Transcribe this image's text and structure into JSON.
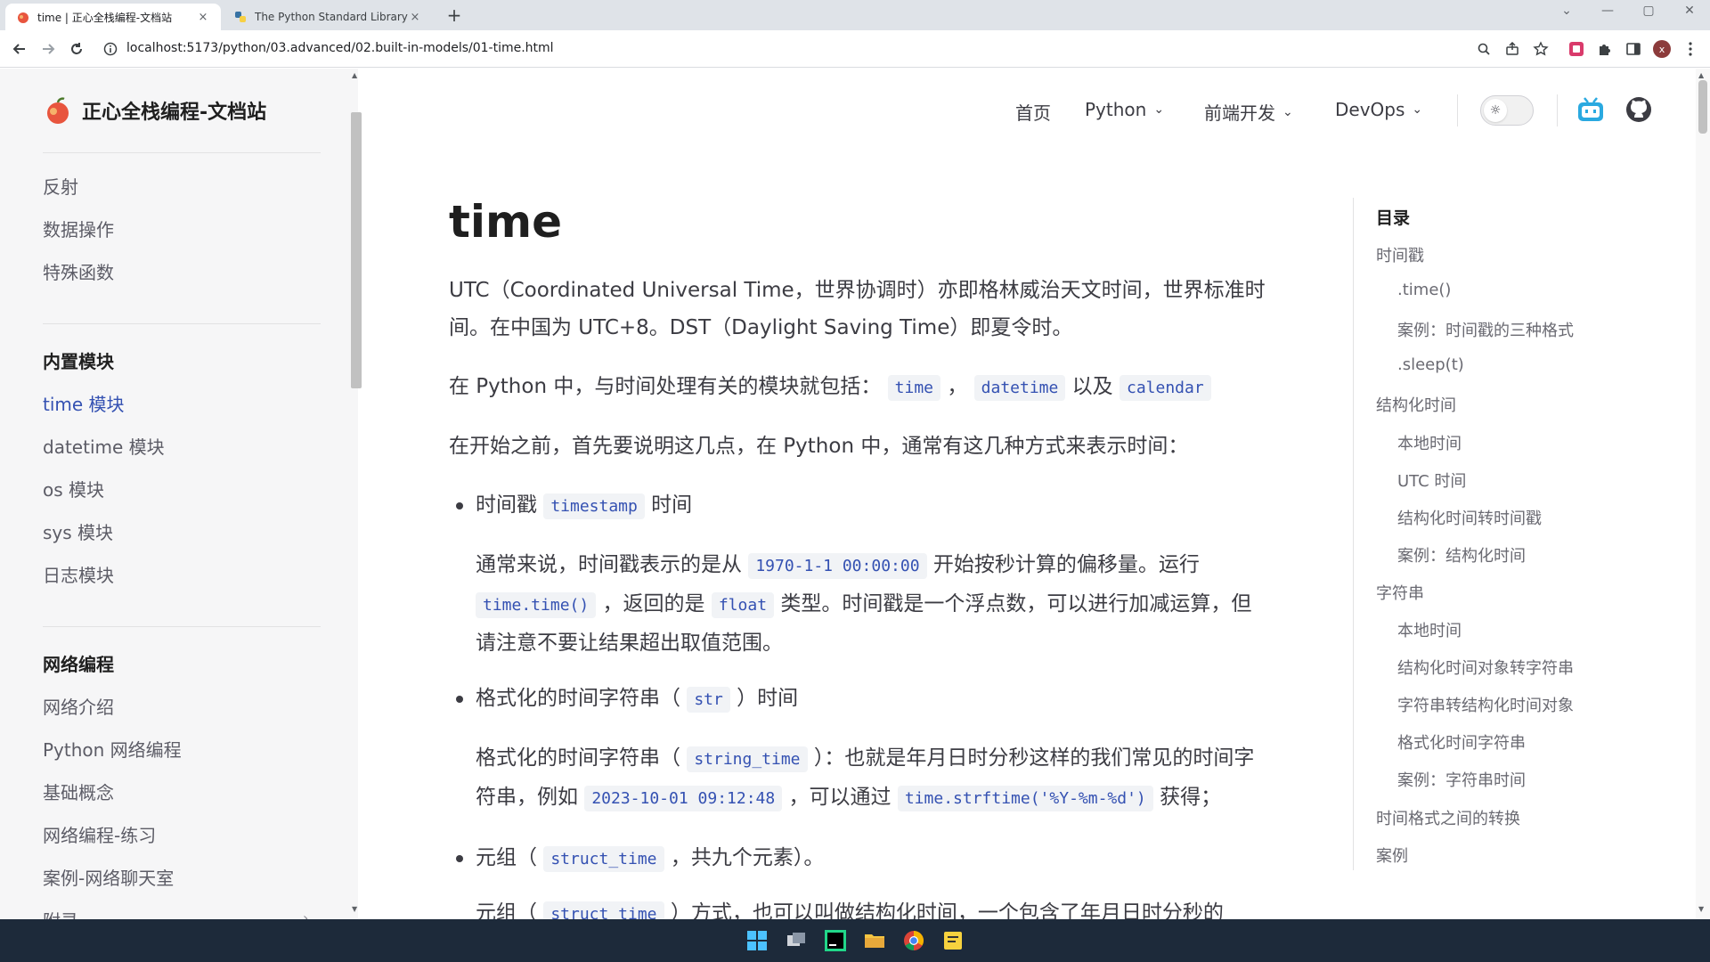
{
  "browser": {
    "tabs": [
      {
        "label": "time | 正心全栈编程-文档站",
        "close": "×",
        "active": true
      },
      {
        "label": "The Python Standard Library ·",
        "close": "×",
        "active": false
      }
    ],
    "new_tab": "+",
    "address": "localhost:5173/python/03.advanced/02.built-in-models/01-time.html",
    "window_controls": {
      "collapse": "⌄",
      "minimize": "—",
      "maximize": "▢",
      "close": "✕"
    },
    "profile_initial": "x"
  },
  "site": {
    "name": "正心全栈编程-文档站"
  },
  "nav": {
    "home": "首页",
    "python": "Python",
    "frontend": "前端开发",
    "devops": "DevOps"
  },
  "sidebar": {
    "top_items": [
      "反射",
      "数据操作",
      "特殊函数"
    ],
    "group1_title": "内置模块",
    "group1_items": [
      "time 模块",
      "datetime 模块",
      "os 模块",
      "sys 模块",
      "日志模块"
    ],
    "group2_title": "网络编程",
    "group2_items": [
      "网络介绍",
      "Python 网络编程",
      "基础概念",
      "网络编程-练习",
      "案例-网络聊天室"
    ],
    "cut_item": "附录"
  },
  "content": {
    "title": "time",
    "p1": "UTC（Coordinated Universal Time，世界协调时）亦即格林威治天文时间，世界标准时间。在中国为 UTC+8。DST（Daylight Saving Time）即夏令时。",
    "p2_a": "在 Python 中，与时间处理有关的模块就包括：",
    "p2_code1": "time",
    "p2_b": "，",
    "p2_code2": "datetime",
    "p2_c": "以及",
    "p2_code3": "calendar",
    "p3": "在开始之前，首先要说明这几点，在 Python 中，通常有这几种方式来表示时间：",
    "b1_a": "时间戳",
    "b1_code": "timestamp",
    "b1_b": "时间",
    "b1p_a": "通常来说，时间戳表示的是从",
    "b1p_code1": "1970-1-1 00:00:00",
    "b1p_b": "开始按秒计算的偏移量。运行",
    "b1p_code2": "time.time()",
    "b1p_c": "，返回的是",
    "b1p_code3": "float",
    "b1p_d": "类型。时间戳是一个浮点数，可以进行加减运算，但请注意不要让结果超出取值范围。",
    "b2_a": "格式化的时间字符串（",
    "b2_code": "str",
    "b2_b": "）时间",
    "b2p_a": "格式化的时间字符串（",
    "b2p_code1": "string_time",
    "b2p_b": "）：也就是年月日时分秒这样的我们常见的时间字符串，例如",
    "b2p_code2": "2023-10-01 09:12:48",
    "b2p_c": "，可以通过",
    "b2p_code3": "time.strftime('%Y-%m-%d')",
    "b2p_d": "获得；",
    "b3_a": "元组（",
    "b3_code": "struct_time",
    "b3_b": "，共九个元素）。",
    "cut_line_a": "元组（",
    "cut_line_code": "struct_time",
    "cut_line_b": "）方式，也可以叫做结构化时间，一个包含了年月日时分秒的"
  },
  "outline": {
    "title": "目录",
    "items": [
      {
        "label": "时间戳",
        "level": 1
      },
      {
        "label": ".time()",
        "level": 2
      },
      {
        "label": "案例：时间戳的三种格式",
        "level": 2
      },
      {
        "label": ".sleep(t)",
        "level": 2
      },
      {
        "label": "结构化时间",
        "level": 1
      },
      {
        "label": "本地时间",
        "level": 2
      },
      {
        "label": "UTC 时间",
        "level": 2
      },
      {
        "label": "结构化时间转时间戳",
        "level": 2
      },
      {
        "label": "案例：结构化时间",
        "level": 2
      },
      {
        "label": "字符串",
        "level": 1
      },
      {
        "label": "本地时间",
        "level": 2
      },
      {
        "label": "结构化时间对象转字符串",
        "level": 2
      },
      {
        "label": "字符串转结构化时间对象",
        "level": 2
      },
      {
        "label": "格式化时间字符串",
        "level": 2
      },
      {
        "label": "案例：字符串时间",
        "level": 2
      },
      {
        "label": "时间格式之间的转换",
        "level": 1
      },
      {
        "label": "案例",
        "level": 1
      }
    ]
  },
  "colors": {
    "brand": "#3451b2",
    "code_bg": "#f1f3f6",
    "sidebar_bg": "#f6f6f7",
    "taskbar_bg": "#1d2a3a"
  }
}
